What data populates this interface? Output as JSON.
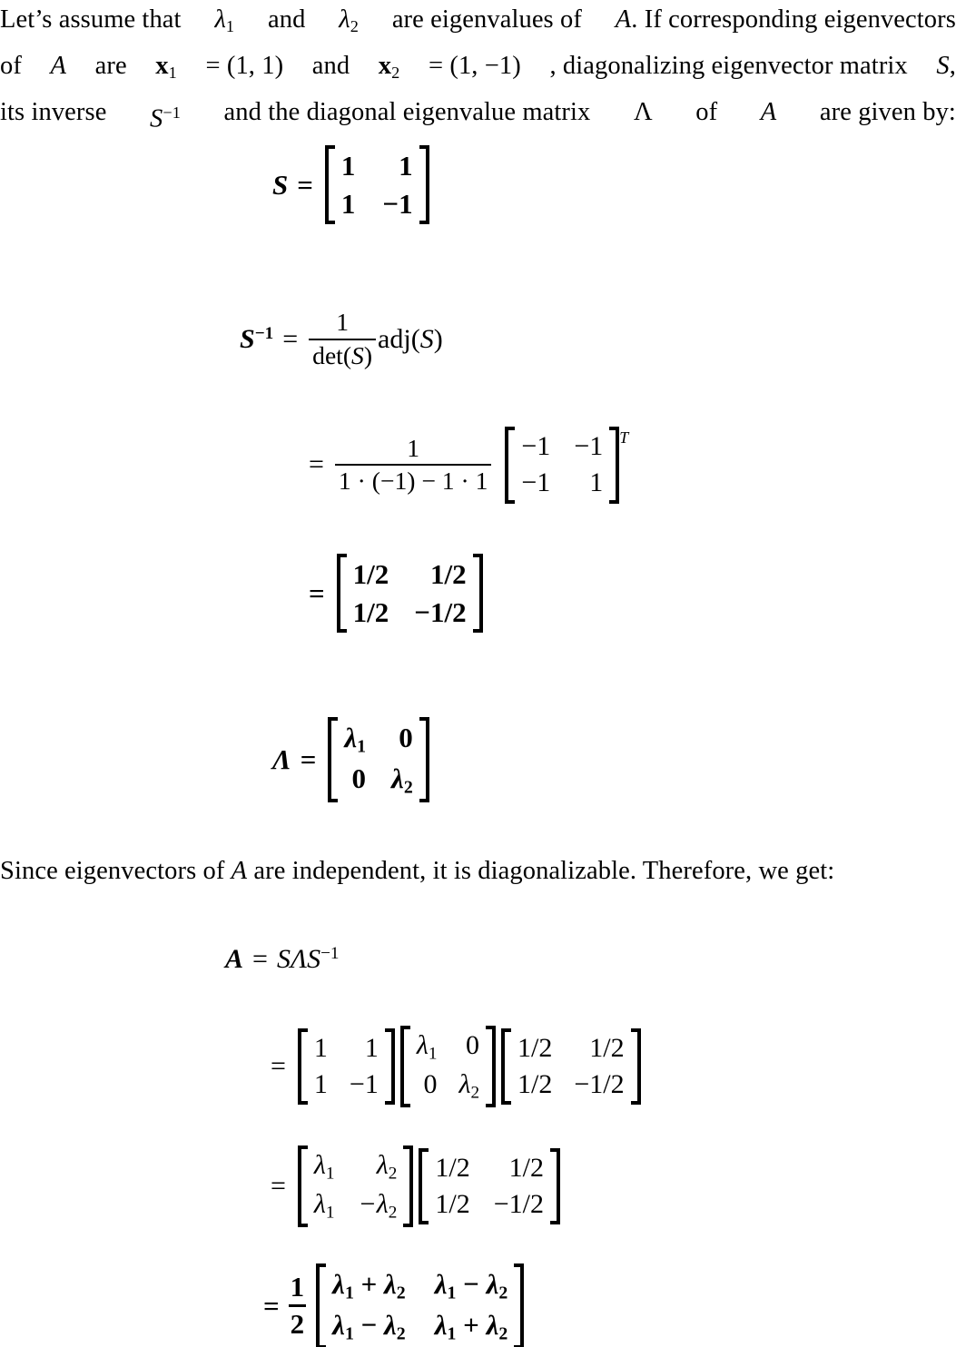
{
  "document": {
    "type": "math-worksheet-solution",
    "background": "#ffffff",
    "text_color": "#000000"
  },
  "intro_paragraph": {
    "line1_a": "Let’s assume that",
    "line1_lam1": "λ",
    "line1_sub1": "1",
    "line1_b": "and",
    "line1_lam2": "λ",
    "line1_sub2": "2",
    "line1_c": "are eigenvalues of",
    "line1_A": "A",
    "line1_d": ". If corresponding eigenvectors",
    "line2_a": "of",
    "line2_A": "A",
    "line2_b": "are",
    "line2_x1": "x",
    "line2_x1sub": "1",
    "line2_eq1": "= (1, 1)",
    "line2_c": "and",
    "line2_x2": "x",
    "line2_x2sub": "2",
    "line2_eq2": "= (1, −1)",
    "line2_d": ", diagonalizing eigenvector matrix",
    "line2_S": "S",
    "line2_e": ",",
    "line3_a": "its inverse",
    "line3_S": "S",
    "line3_Ssup": "−1",
    "line3_b": "and the diagonal eigenvalue matrix",
    "line3_Lambda": "Λ",
    "line3_c": "of",
    "line3_A": "A",
    "line3_d": "are given by:"
  },
  "equation_S": {
    "lhs": "S",
    "eq": "=",
    "matrix": [
      [
        "1",
        "1"
      ],
      [
        "1",
        "−1"
      ]
    ]
  },
  "equation_Sinv_def": {
    "lhs": "S",
    "lhs_sup": "−1",
    "eq": "=",
    "frac_num": "1",
    "frac_den_det": "det(",
    "frac_den_S": "S",
    "frac_den_close": ")",
    "adj_name": "adj(",
    "adj_S": "S",
    "adj_close": ")"
  },
  "equation_Sinv_step": {
    "eq": "=",
    "frac_num": "1",
    "frac_den": "1 · (−1) − 1 · 1",
    "matrix": [
      [
        "−1",
        "−1"
      ],
      [
        "−1",
        "1"
      ]
    ],
    "transpose": "T"
  },
  "equation_Sinv_result": {
    "eq": "=",
    "matrix": [
      [
        "1/2",
        "1/2"
      ],
      [
        "1/2",
        "−1/2"
      ]
    ]
  },
  "equation_Lambda": {
    "lhs": "Λ",
    "eq": "=",
    "matrix": [
      [
        "λ1",
        "0"
      ],
      [
        "0",
        "λ2"
      ]
    ],
    "cells": [
      [
        {
          "base": "λ",
          "sub": "1"
        },
        {
          "base": "0",
          "sub": ""
        }
      ],
      [
        {
          "base": "0",
          "sub": ""
        },
        {
          "base": "λ",
          "sub": "2"
        }
      ]
    ]
  },
  "since_paragraph": {
    "text_a": "Since eigenvectors of",
    "text_A": "A",
    "text_b": "are independent, it is diagonalizable.  Therefore, we get:"
  },
  "equation_A_def": {
    "lhs": "A",
    "eq": "=",
    "rhs_S": "S",
    "rhs_Lambda": "Λ",
    "rhs_Sinv": "S",
    "rhs_Sinv_sup": "−1"
  },
  "equation_A_step1": {
    "eq": "=",
    "matrix1": [
      [
        "1",
        "1"
      ],
      [
        "1",
        "−1"
      ]
    ],
    "matrix2_cells": [
      [
        {
          "base": "λ",
          "sub": "1"
        },
        {
          "base": "0",
          "sub": ""
        }
      ],
      [
        {
          "base": "0",
          "sub": ""
        },
        {
          "base": "λ",
          "sub": "2"
        }
      ]
    ],
    "matrix3": [
      [
        "1/2",
        "1/2"
      ],
      [
        "1/2",
        "−1/2"
      ]
    ]
  },
  "equation_A_step2": {
    "eq": "=",
    "matrix1_cells": [
      [
        {
          "base": "λ",
          "sub": "1"
        },
        {
          "base": "λ",
          "sub": "2"
        }
      ],
      [
        {
          "base": "λ",
          "sub": "1"
        },
        {
          "base": "−λ",
          "sub": "2"
        }
      ]
    ],
    "matrix2": [
      [
        "1/2",
        "1/2"
      ],
      [
        "1/2",
        "−1/2"
      ]
    ]
  },
  "equation_A_final": {
    "eq": "=",
    "frac_num": "1",
    "frac_den": "2",
    "matrix_cells": [
      [
        {
          "t1": "λ",
          "s1": "1",
          "op": "+",
          "t2": "λ",
          "s2": "2"
        },
        {
          "t1": "λ",
          "s1": "1",
          "op": "−",
          "t2": "λ",
          "s2": "2"
        }
      ],
      [
        {
          "t1": "λ",
          "s1": "1",
          "op": "−",
          "t2": "λ",
          "s2": "2"
        },
        {
          "t1": "λ",
          "s1": "1",
          "op": "+",
          "t2": "λ",
          "s2": "2"
        }
      ]
    ]
  }
}
